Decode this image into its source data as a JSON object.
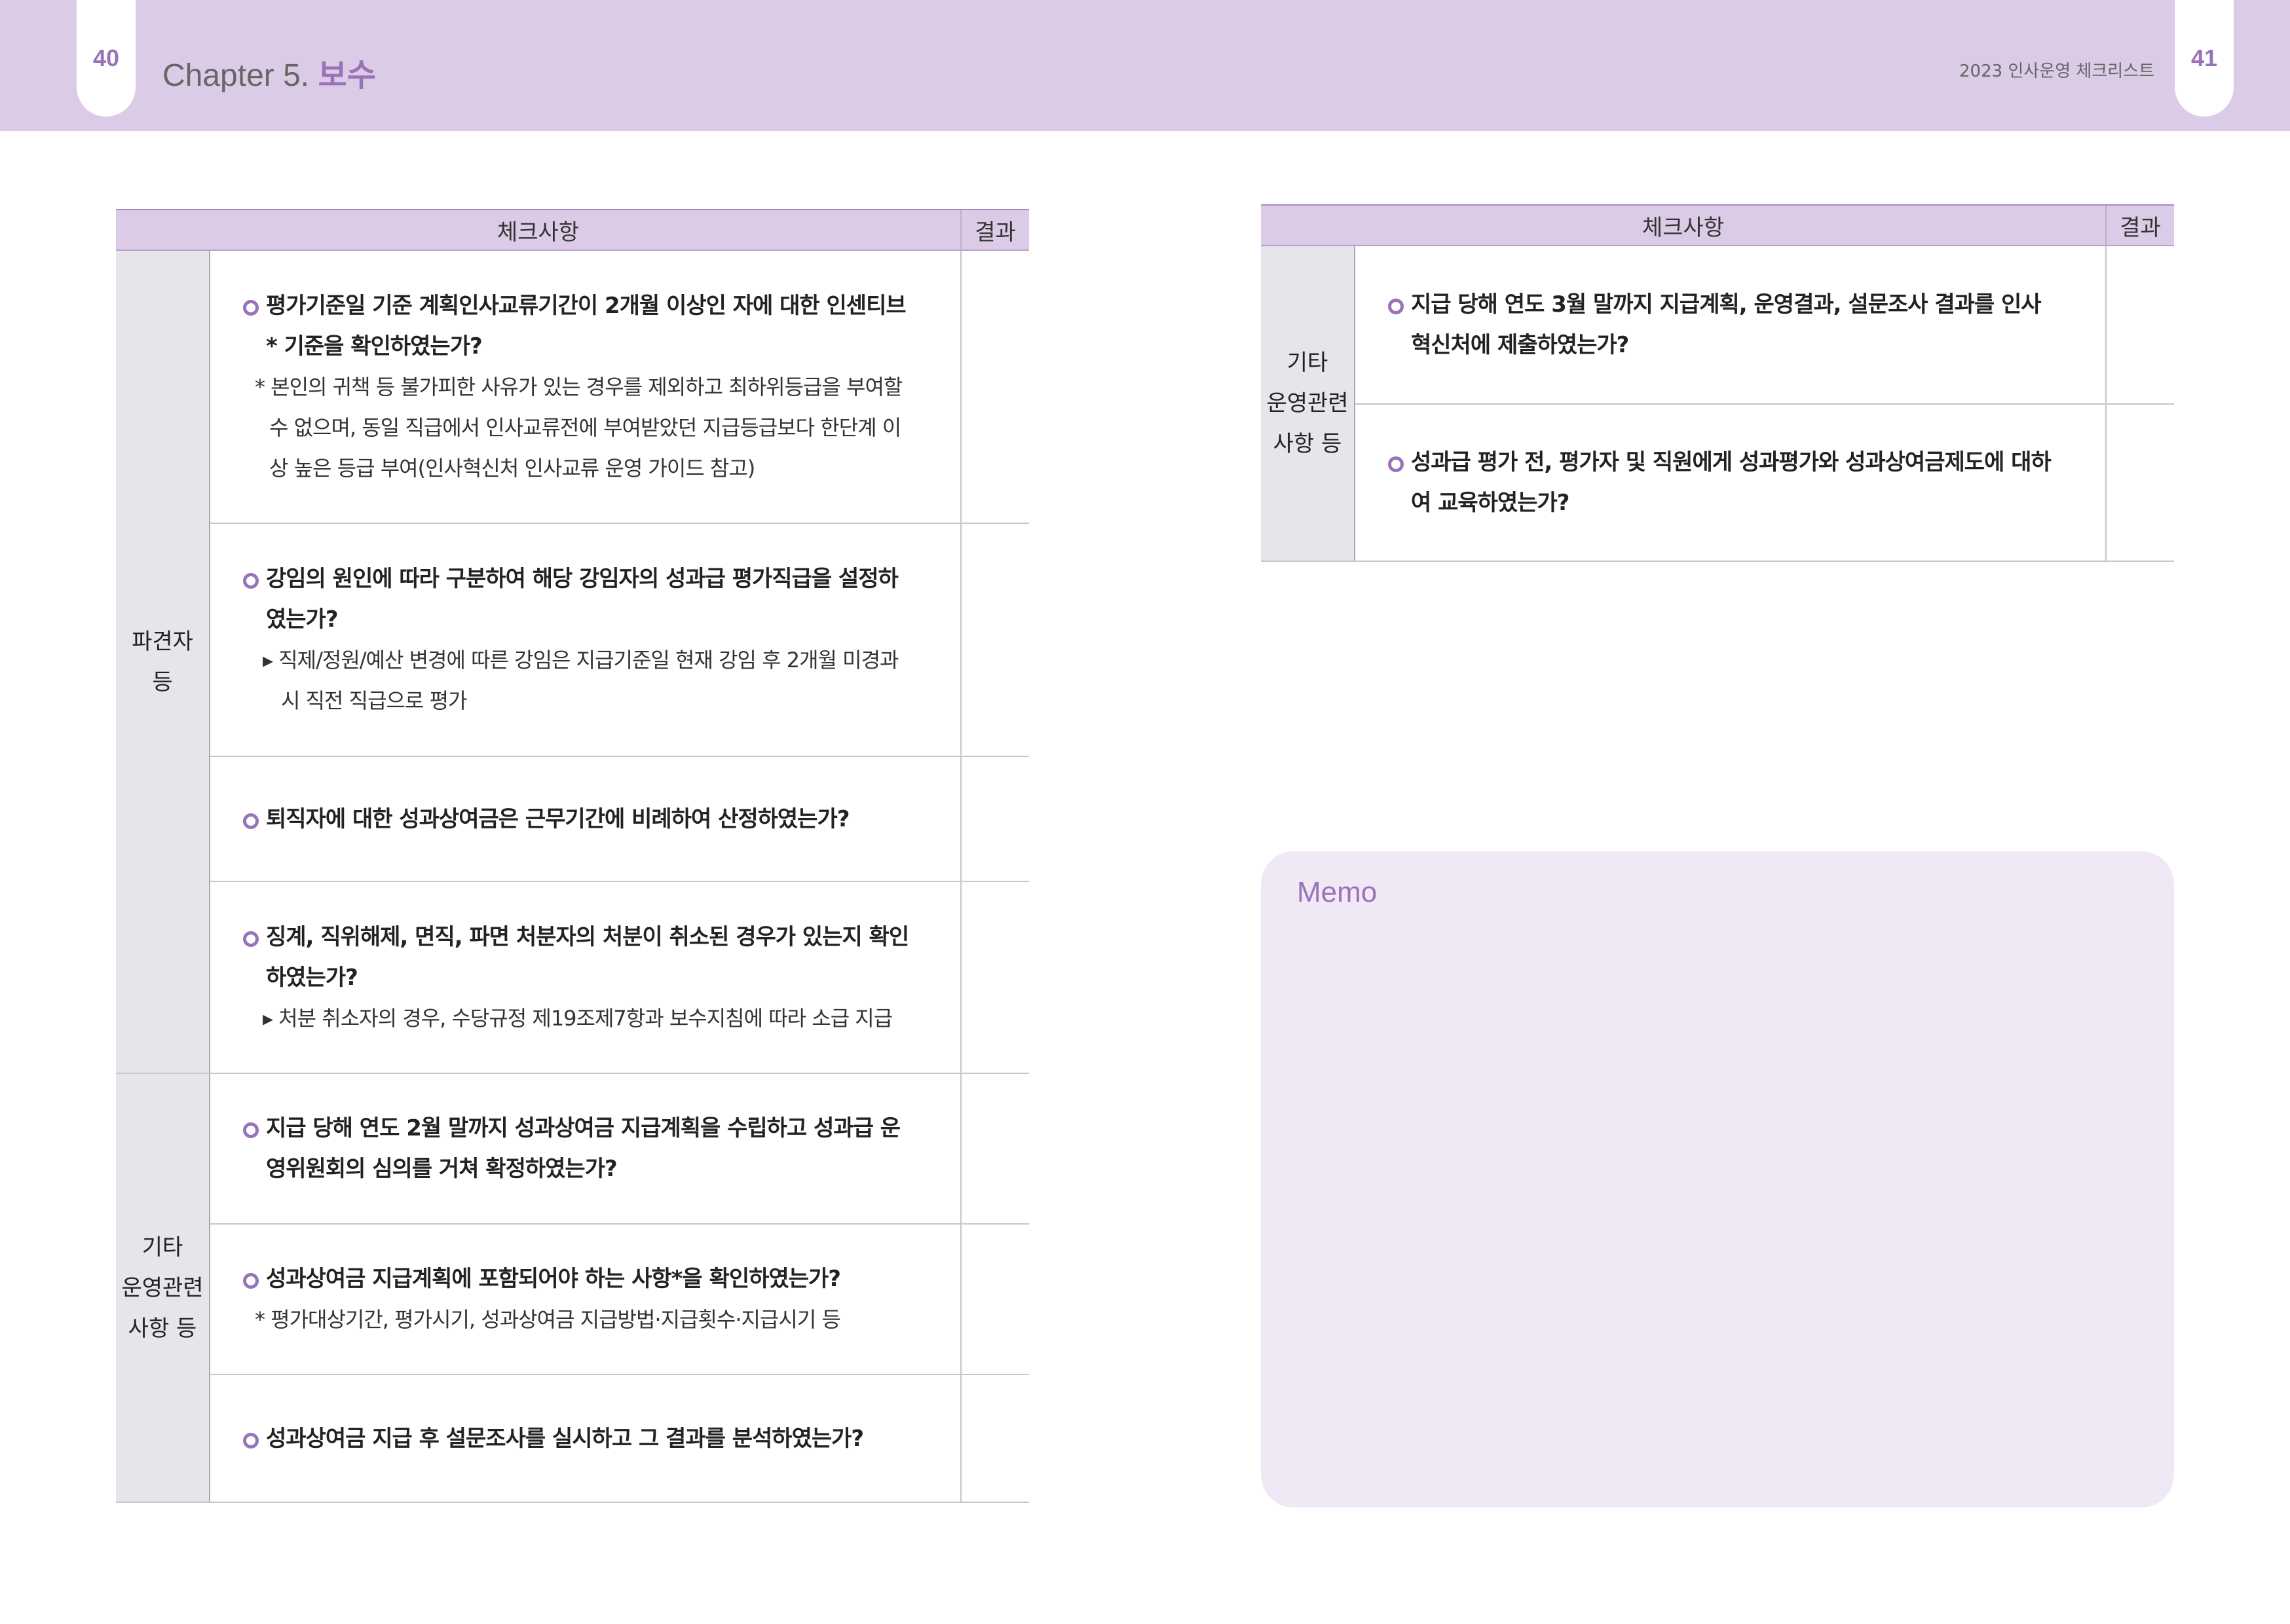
{
  "header": {
    "left_page_number": "40",
    "right_page_number": "41",
    "chapter_prefix": "Chapter 5.",
    "chapter_title": "보수",
    "running_head": "2023 인사운영 체크리스트"
  },
  "left_table": {
    "columns": [
      "체크사항",
      "결과"
    ],
    "groups": [
      {
        "category": [
          "파견자",
          "등"
        ],
        "rows": [
          {
            "question": "평가기준일 기준 계획인사교류기간이 2개월 이상인 자에 대한 인센티브* 기준을 확인하였는가?",
            "note": "* 본인의 귀책 등 불가피한 사유가 있는 경우를 제외하고 최하위등급을 부여할 수 없으며, 동일 직급에서 인사교류전에 부여받았던 지급등급보다 한단계 이상 높은 등급 부여(인사혁신처 인사교류 운영 가이드 참고)"
          },
          {
            "question": "강임의 원인에 따라 구분하여 해당 강임자의 성과급 평가직급을 설정하였는가?",
            "note": "▸ 직제/정원/예산 변경에 따른 강임은 지급기준일 현재 강임 후 2개월 미경과시 직전 직급으로 평가"
          },
          {
            "question": "퇴직자에 대한 성과상여금은 근무기간에 비례하여 산정하였는가?",
            "note": ""
          },
          {
            "question": "징계, 직위해제, 면직, 파면 처분자의 처분이 취소된 경우가 있는지 확인하였는가?",
            "note": "▸ 처분 취소자의 경우, 수당규정 제19조제7항과 보수지침에 따라 소급 지급"
          }
        ]
      },
      {
        "category": [
          "기타",
          "운영관련",
          "사항 등"
        ],
        "rows": [
          {
            "question": "지급 당해 연도 2월 말까지 성과상여금 지급계획을 수립하고 성과급 운영위원회의 심의를 거쳐 확정하였는가?",
            "note": ""
          },
          {
            "question": "성과상여금 지급계획에 포함되어야 하는 사항*을 확인하였는가?",
            "note": "* 평가대상기간, 평가시기, 성과상여금 지급방법·지급횟수·지급시기 등"
          },
          {
            "question": "성과상여금 지급 후 설문조사를 실시하고 그 결과를 분석하였는가?",
            "note": ""
          }
        ]
      }
    ]
  },
  "right_table": {
    "columns": [
      "체크사항",
      "결과"
    ],
    "groups": [
      {
        "category": [
          "기타",
          "운영관련",
          "사항 등"
        ],
        "rows": [
          {
            "question": "지급 당해 연도 3월 말까지 지급계획, 운영결과, 설문조사 결과를 인사혁신처에 제출하였는가?",
            "note": ""
          },
          {
            "question": "성과급 평가 전, 평가자 및 직원에게 성과평가와 성과상여금제도에 대하여 교육하였는가?",
            "note": ""
          }
        ]
      }
    ]
  },
  "memo": {
    "title": "Memo"
  },
  "colors": {
    "accent_purple": "#9a72b8",
    "header_band": "#dccbe6",
    "category_gray": "#e6e6ea",
    "memo_bg": "#f0e9f5"
  }
}
